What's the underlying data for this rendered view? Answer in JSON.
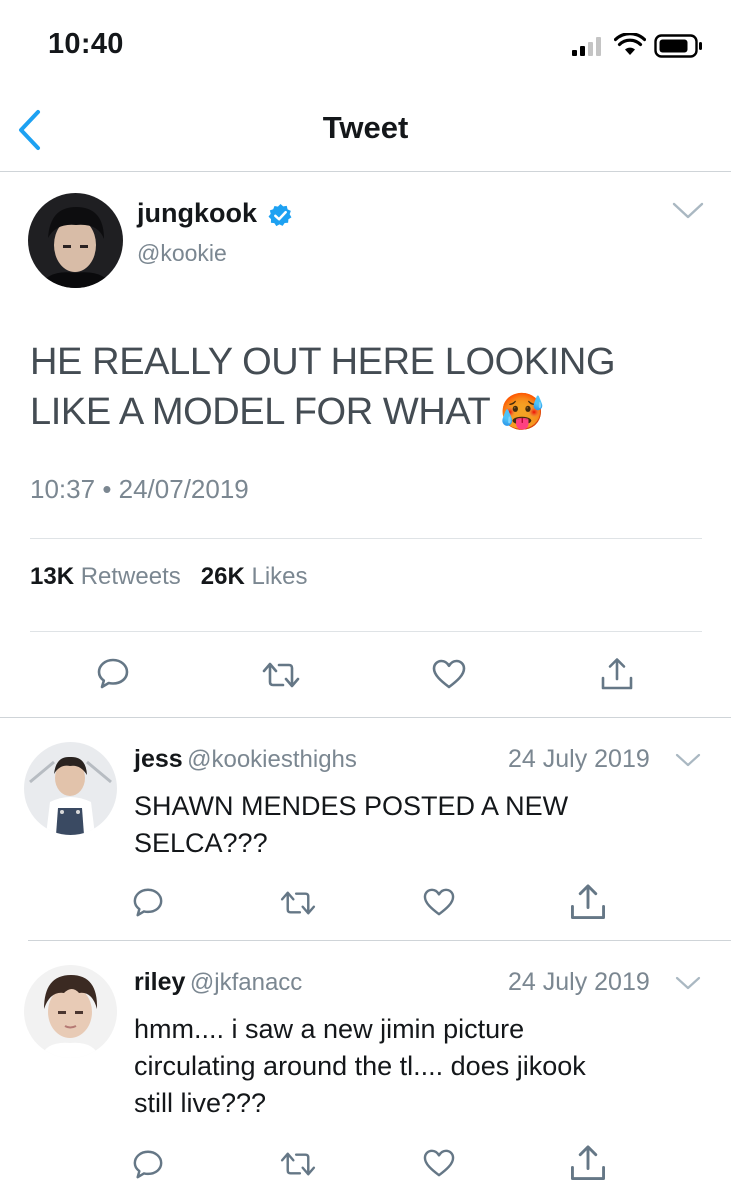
{
  "status_bar": {
    "time": "10:40"
  },
  "nav": {
    "title": "Tweet"
  },
  "main_tweet": {
    "name": "jungkook",
    "handle": "@kookie",
    "text": "HE REALLY OUT HERE LOOKING LIKE A MODEL FOR WHAT",
    "emoji": "🥵",
    "time": "10:37",
    "date": "24/07/2019",
    "retweets_count": "13K",
    "retweets_label": "Retweets",
    "likes_count": "26K",
    "likes_label": "Likes"
  },
  "replies": [
    {
      "name": "jess",
      "handle": "@kookiesthighs",
      "date": "24 July 2019",
      "line1": "SHAWN MENDES POSTED A NEW",
      "line2": "SELCA???"
    },
    {
      "name": "riley",
      "handle": "@jkfanacc",
      "date": "24 July 2019",
      "line1": "hmm.... i saw a new jimin picture",
      "line2": "circulating around the tl.... does jikook",
      "line3": "still live???"
    }
  ],
  "colors": {
    "accent": "#1da1f2",
    "icon_grey": "#657786",
    "text_grey": "#7b8791"
  }
}
